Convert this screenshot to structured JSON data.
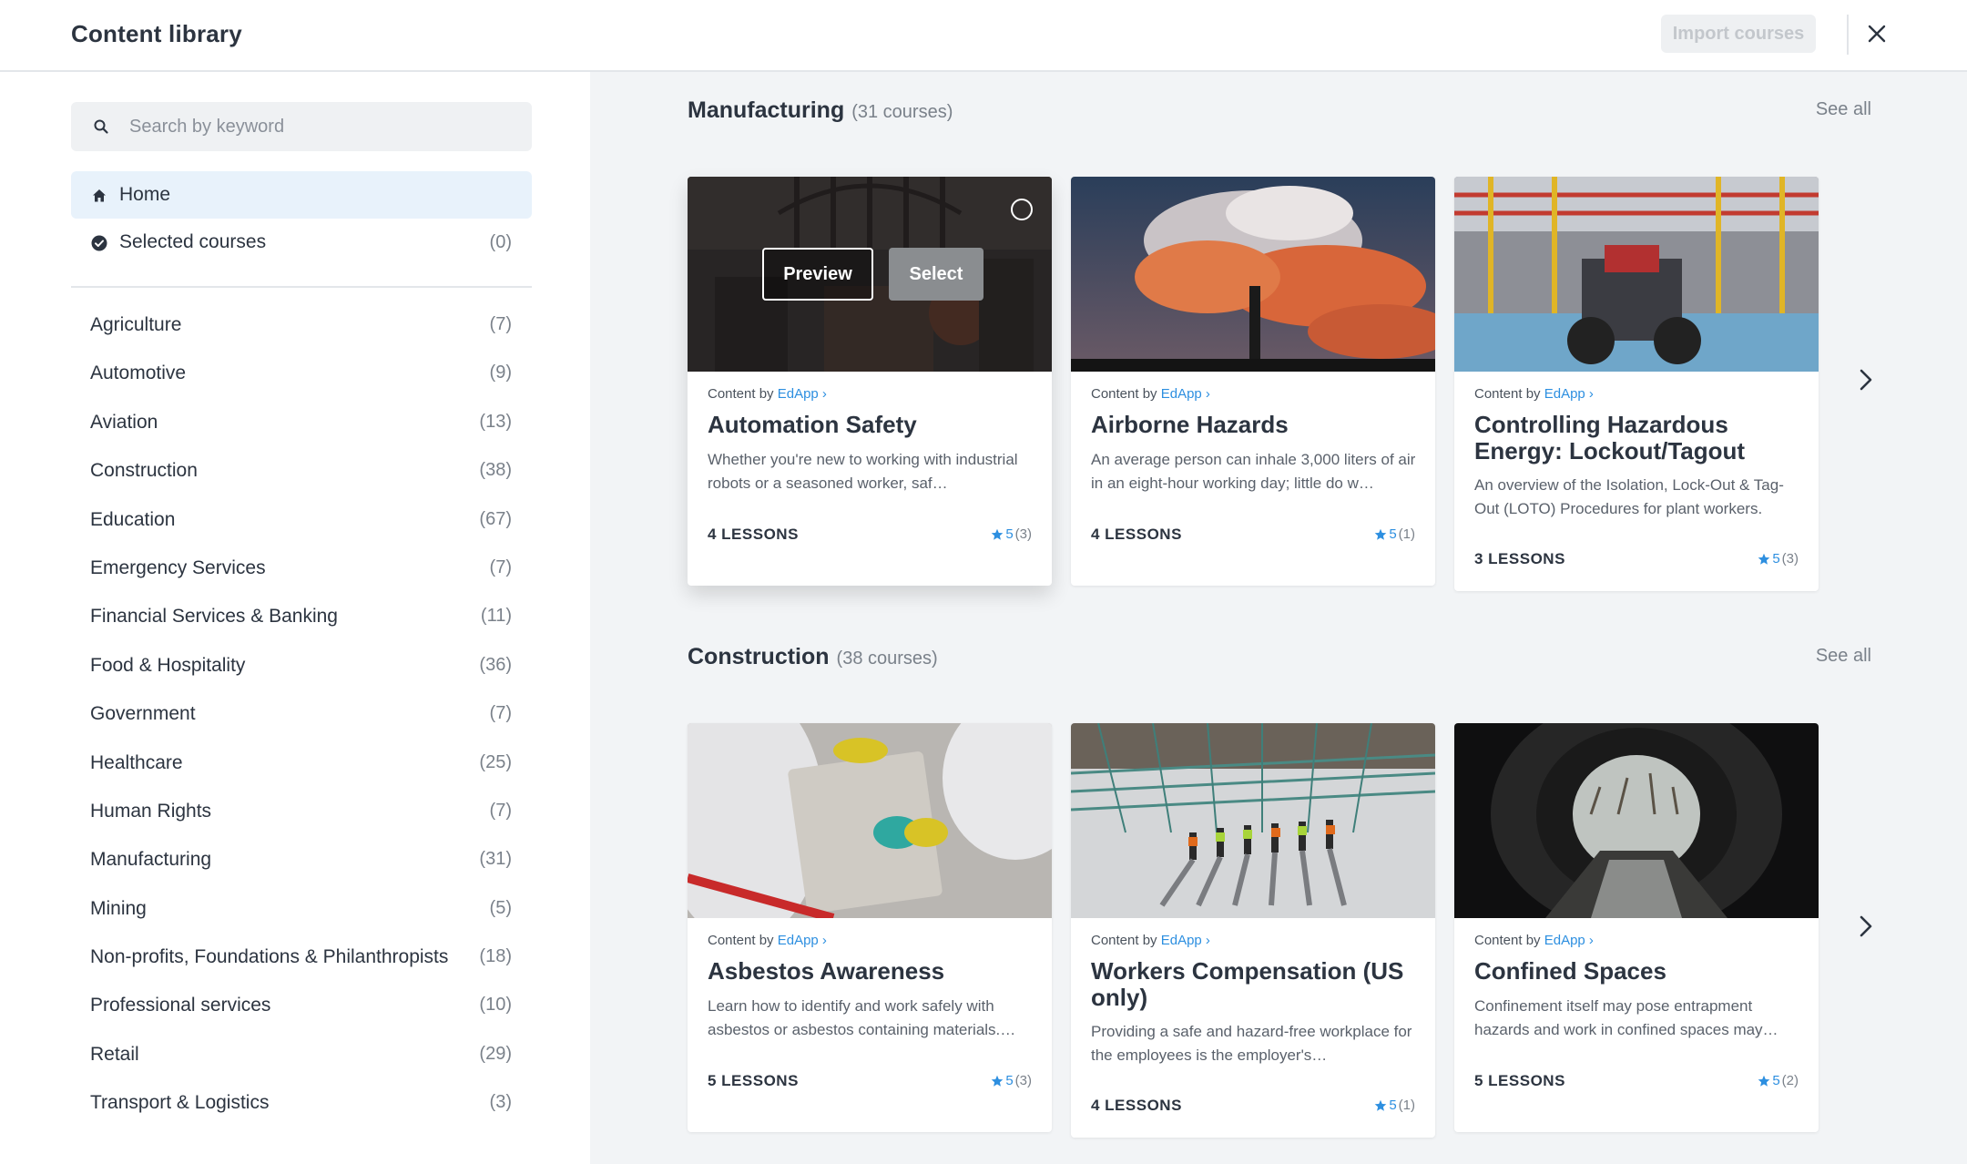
{
  "header": {
    "title": "Content library",
    "import_label": "Import courses"
  },
  "sidebar": {
    "search_placeholder": "Search by keyword",
    "nav": [
      {
        "label": "Home",
        "count": ""
      },
      {
        "label": "Selected courses",
        "count": "(0)"
      }
    ],
    "categories": [
      {
        "label": "Agriculture",
        "count": "(7)"
      },
      {
        "label": "Automotive",
        "count": "(9)"
      },
      {
        "label": "Aviation",
        "count": "(13)"
      },
      {
        "label": "Construction",
        "count": "(38)"
      },
      {
        "label": "Education",
        "count": "(67)"
      },
      {
        "label": "Emergency Services",
        "count": "(7)"
      },
      {
        "label": "Financial Services & Banking",
        "count": "(11)"
      },
      {
        "label": "Food & Hospitality",
        "count": "(36)"
      },
      {
        "label": "Government",
        "count": "(7)"
      },
      {
        "label": "Healthcare",
        "count": "(25)"
      },
      {
        "label": "Human Rights",
        "count": "(7)"
      },
      {
        "label": "Manufacturing",
        "count": "(31)"
      },
      {
        "label": "Mining",
        "count": "(5)"
      },
      {
        "label": "Non-profits, Foundations & Philanthropists",
        "count": "(18)"
      },
      {
        "label": "Professional services",
        "count": "(10)"
      },
      {
        "label": "Retail",
        "count": "(29)"
      },
      {
        "label": "Transport & Logistics",
        "count": "(3)"
      }
    ]
  },
  "sections": [
    {
      "title": "Manufacturing",
      "count": "(31 courses)",
      "see_all": "See all",
      "cards": [
        {
          "by_prefix": "Content by",
          "by_link": "EdApp",
          "title": "Automation Safety",
          "desc": "Whether you're new to working with industrial robots or a seasoned worker, saf…",
          "lessons": "4 LESSONS",
          "rating": "5",
          "reviews": "(3)"
        },
        {
          "by_prefix": "Content by",
          "by_link": "EdApp",
          "title": "Airborne Hazards",
          "desc": "An average person can inhale 3,000 liters of air in an eight-hour working day; little do w…",
          "lessons": "4 LESSONS",
          "rating": "5",
          "reviews": "(1)"
        },
        {
          "by_prefix": "Content by",
          "by_link": "EdApp",
          "title": "Controlling Hazardous Energy: Lockout/Tagout",
          "desc": "An overview of the Isolation, Lock-Out & Tag-Out (LOTO) Procedures for plant workers.",
          "lessons": "3 LESSONS",
          "rating": "5",
          "reviews": "(3)"
        }
      ]
    },
    {
      "title": "Construction",
      "count": "(38 courses)",
      "see_all": "See all",
      "cards": [
        {
          "by_prefix": "Content by",
          "by_link": "EdApp",
          "title": "Asbestos Awareness",
          "desc": "Learn how to identify and work safely with asbestos or asbestos containing materials.…",
          "lessons": "5 LESSONS",
          "rating": "5",
          "reviews": "(3)"
        },
        {
          "by_prefix": "Content by",
          "by_link": "EdApp",
          "title": "Workers Compensation (US only)",
          "desc": "Providing a safe and hazard-free workplace for the employees is the employer's…",
          "lessons": "4 LESSONS",
          "rating": "5",
          "reviews": "(1)"
        },
        {
          "by_prefix": "Content by",
          "by_link": "EdApp",
          "title": "Confined Spaces",
          "desc": "Confinement itself may pose entrapment hazards and work in confined spaces may…",
          "lessons": "5 LESSONS",
          "rating": "5",
          "reviews": "(2)"
        }
      ]
    }
  ],
  "overlay": {
    "preview_label": "Preview",
    "select_label": "Select"
  },
  "colors": {
    "accent": "#2d8fe0",
    "active_nav_bg": "#e8f2fb",
    "main_bg": "#f2f4f6"
  },
  "icons": {
    "search": "search-icon",
    "home": "home-icon",
    "selected": "check-circle-icon",
    "close": "close-icon",
    "next": "chevron-right-icon",
    "star": "star-icon"
  }
}
